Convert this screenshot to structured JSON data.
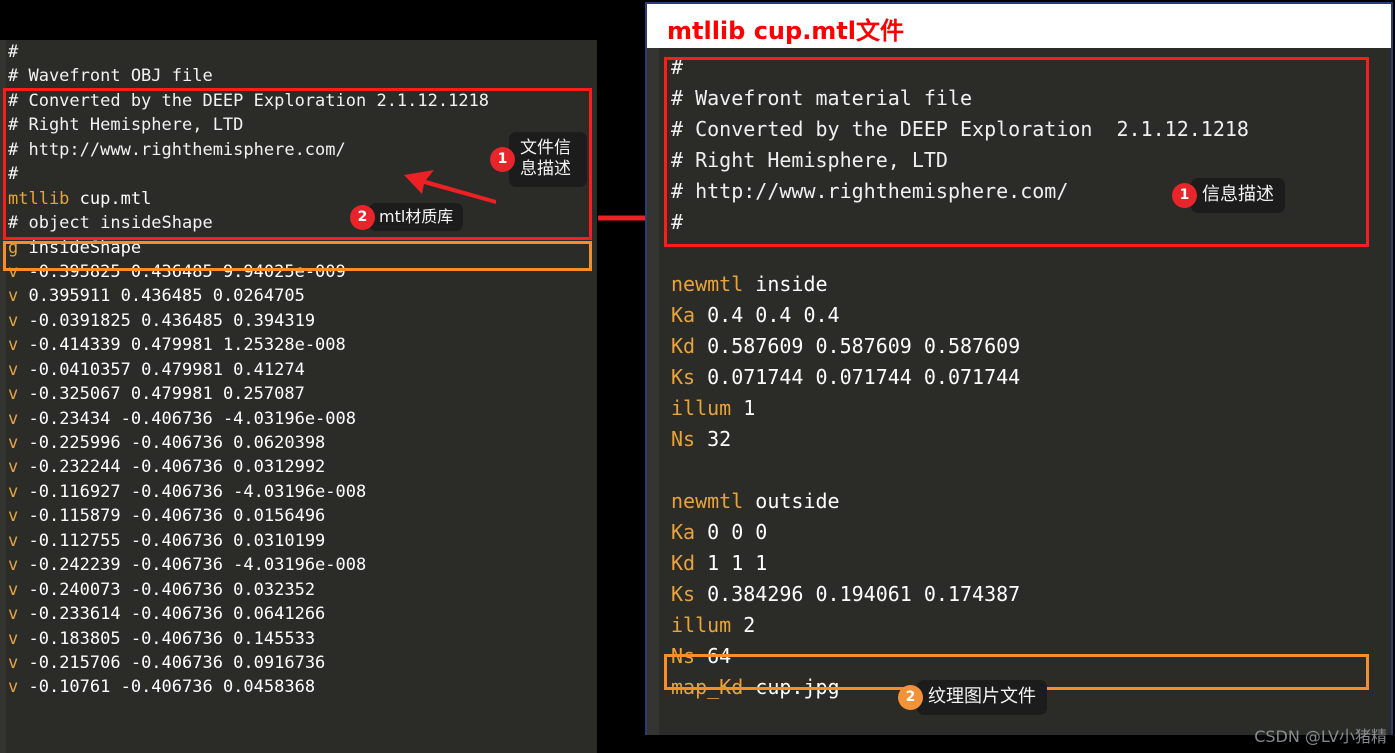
{
  "left_panel": {
    "name": "obj-file-editor",
    "lines": [
      "#",
      "# Wavefront OBJ file",
      "# Converted by the DEEP Exploration 2.1.12.1218",
      "# Right Hemisphere, LTD",
      "# http://www.righthemisphere.com/",
      "#",
      "mtllib cup.mtl",
      "# object insideShape",
      "g insideShape",
      "v -0.395825 0.436485 9.94025e-009",
      "v 0.395911 0.436485 0.0264705",
      "v -0.0391825 0.436485 0.394319",
      "v -0.414339 0.479981 1.25328e-008",
      "v -0.0410357 0.479981 0.41274",
      "v -0.325067 0.479981 0.257087",
      "v -0.23434 -0.406736 -4.03196e-008",
      "v -0.225996 -0.406736 0.0620398",
      "v -0.232244 -0.406736 0.0312992",
      "v -0.116927 -0.406736 -4.03196e-008",
      "v -0.115879 -0.406736 0.0156496",
      "v -0.112755 -0.406736 0.0310199",
      "v -0.242239 -0.406736 -4.03196e-008",
      "v -0.240073 -0.406736 0.032352",
      "v -0.233614 -0.406736 0.0641266",
      "v -0.183805 -0.406736 0.145533",
      "v -0.215706 -0.406736 0.0916736",
      "v -0.10761 -0.406736 0.0458368"
    ],
    "highlight_red_lines": [
      0,
      1,
      2,
      3,
      4,
      5
    ],
    "highlight_orange_lines": [
      6
    ]
  },
  "right_panel": {
    "name": "mtl-file-viewer",
    "title": "mtllib cup.mtl文件",
    "lines": [
      "#",
      "# Wavefront material file",
      "# Converted by the DEEP Exploration  2.1.12.1218",
      "# Right Hemisphere, LTD",
      "# http://www.righthemisphere.com/",
      "#",
      "",
      "newmtl inside",
      "Ka 0.4 0.4 0.4",
      "Kd 0.587609 0.587609 0.587609",
      "Ks 0.071744 0.071744 0.071744",
      "illum 1",
      "Ns 32",
      "",
      "newmtl outside",
      "Ka 0 0 0",
      "Kd 1 1 1",
      "Ks 0.384296 0.194061 0.174387",
      "illum 2",
      "Ns 64",
      "map_Kd cup.jpg"
    ]
  },
  "callouts": {
    "left_1": {
      "number": "1",
      "label": "文件信\n息描述",
      "color": "#e8252a"
    },
    "left_2": {
      "number": "2",
      "label": "mtl材质库",
      "color": "#e8252a"
    },
    "right_1": {
      "number": "1",
      "label": "信息描述",
      "color": "#e8252a"
    },
    "right_2": {
      "number": "2",
      "label": "纹理图片文件",
      "color": "#f2933a"
    }
  },
  "watermark": "CSDN @LV小猪精",
  "colors": {
    "editor_bg": "#2b2b28",
    "red_box": "#fb1c1c",
    "orange_box": "#f78e28",
    "title_text": "#ff0000",
    "panel_border": "#2a3c7a",
    "keyword": "#e8a33d"
  }
}
